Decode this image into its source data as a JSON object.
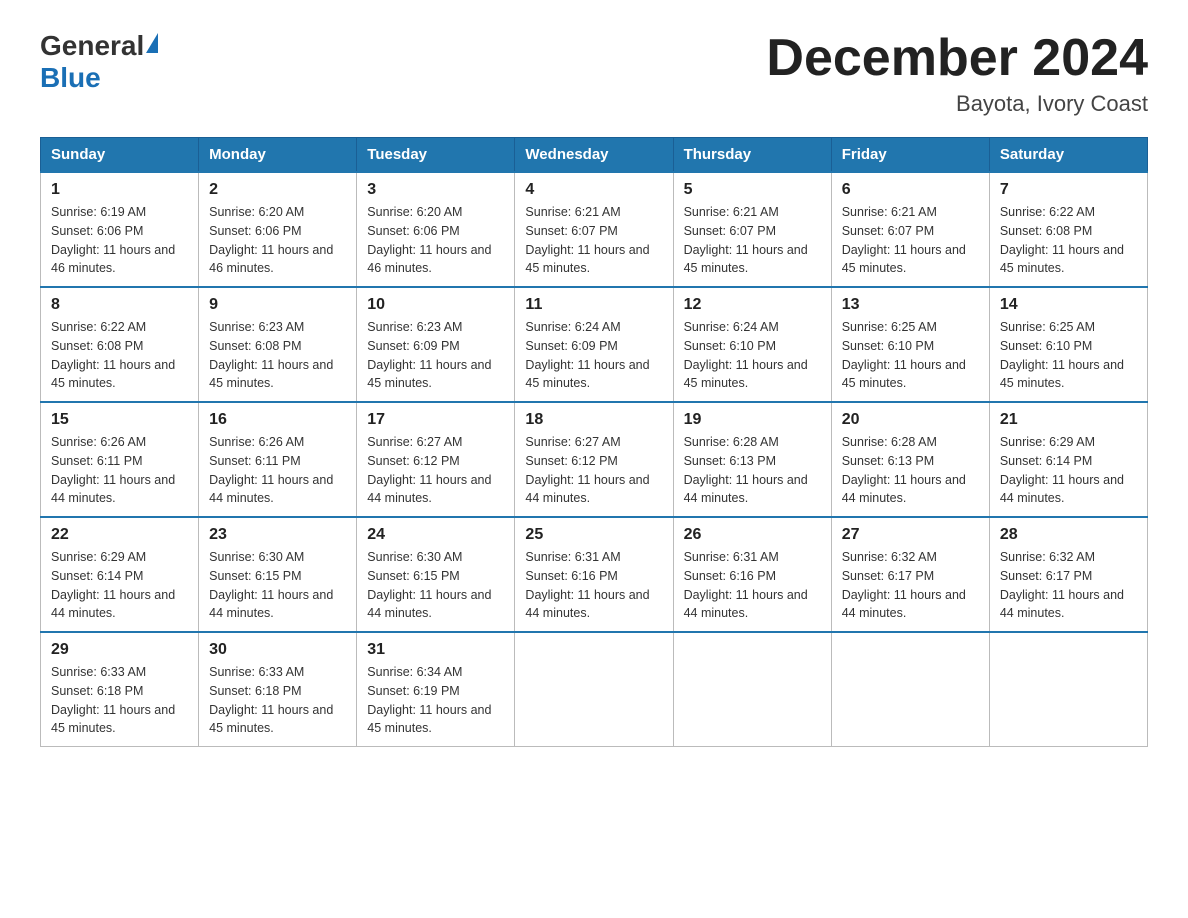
{
  "logo": {
    "general": "General",
    "blue": "Blue"
  },
  "header": {
    "month_year": "December 2024",
    "location": "Bayota, Ivory Coast"
  },
  "weekdays": [
    "Sunday",
    "Monday",
    "Tuesday",
    "Wednesday",
    "Thursday",
    "Friday",
    "Saturday"
  ],
  "weeks": [
    [
      {
        "day": "1",
        "sunrise": "6:19 AM",
        "sunset": "6:06 PM",
        "daylight": "11 hours and 46 minutes."
      },
      {
        "day": "2",
        "sunrise": "6:20 AM",
        "sunset": "6:06 PM",
        "daylight": "11 hours and 46 minutes."
      },
      {
        "day": "3",
        "sunrise": "6:20 AM",
        "sunset": "6:06 PM",
        "daylight": "11 hours and 46 minutes."
      },
      {
        "day": "4",
        "sunrise": "6:21 AM",
        "sunset": "6:07 PM",
        "daylight": "11 hours and 45 minutes."
      },
      {
        "day": "5",
        "sunrise": "6:21 AM",
        "sunset": "6:07 PM",
        "daylight": "11 hours and 45 minutes."
      },
      {
        "day": "6",
        "sunrise": "6:21 AM",
        "sunset": "6:07 PM",
        "daylight": "11 hours and 45 minutes."
      },
      {
        "day": "7",
        "sunrise": "6:22 AM",
        "sunset": "6:08 PM",
        "daylight": "11 hours and 45 minutes."
      }
    ],
    [
      {
        "day": "8",
        "sunrise": "6:22 AM",
        "sunset": "6:08 PM",
        "daylight": "11 hours and 45 minutes."
      },
      {
        "day": "9",
        "sunrise": "6:23 AM",
        "sunset": "6:08 PM",
        "daylight": "11 hours and 45 minutes."
      },
      {
        "day": "10",
        "sunrise": "6:23 AM",
        "sunset": "6:09 PM",
        "daylight": "11 hours and 45 minutes."
      },
      {
        "day": "11",
        "sunrise": "6:24 AM",
        "sunset": "6:09 PM",
        "daylight": "11 hours and 45 minutes."
      },
      {
        "day": "12",
        "sunrise": "6:24 AM",
        "sunset": "6:10 PM",
        "daylight": "11 hours and 45 minutes."
      },
      {
        "day": "13",
        "sunrise": "6:25 AM",
        "sunset": "6:10 PM",
        "daylight": "11 hours and 45 minutes."
      },
      {
        "day": "14",
        "sunrise": "6:25 AM",
        "sunset": "6:10 PM",
        "daylight": "11 hours and 45 minutes."
      }
    ],
    [
      {
        "day": "15",
        "sunrise": "6:26 AM",
        "sunset": "6:11 PM",
        "daylight": "11 hours and 44 minutes."
      },
      {
        "day": "16",
        "sunrise": "6:26 AM",
        "sunset": "6:11 PM",
        "daylight": "11 hours and 44 minutes."
      },
      {
        "day": "17",
        "sunrise": "6:27 AM",
        "sunset": "6:12 PM",
        "daylight": "11 hours and 44 minutes."
      },
      {
        "day": "18",
        "sunrise": "6:27 AM",
        "sunset": "6:12 PM",
        "daylight": "11 hours and 44 minutes."
      },
      {
        "day": "19",
        "sunrise": "6:28 AM",
        "sunset": "6:13 PM",
        "daylight": "11 hours and 44 minutes."
      },
      {
        "day": "20",
        "sunrise": "6:28 AM",
        "sunset": "6:13 PM",
        "daylight": "11 hours and 44 minutes."
      },
      {
        "day": "21",
        "sunrise": "6:29 AM",
        "sunset": "6:14 PM",
        "daylight": "11 hours and 44 minutes."
      }
    ],
    [
      {
        "day": "22",
        "sunrise": "6:29 AM",
        "sunset": "6:14 PM",
        "daylight": "11 hours and 44 minutes."
      },
      {
        "day": "23",
        "sunrise": "6:30 AM",
        "sunset": "6:15 PM",
        "daylight": "11 hours and 44 minutes."
      },
      {
        "day": "24",
        "sunrise": "6:30 AM",
        "sunset": "6:15 PM",
        "daylight": "11 hours and 44 minutes."
      },
      {
        "day": "25",
        "sunrise": "6:31 AM",
        "sunset": "6:16 PM",
        "daylight": "11 hours and 44 minutes."
      },
      {
        "day": "26",
        "sunrise": "6:31 AM",
        "sunset": "6:16 PM",
        "daylight": "11 hours and 44 minutes."
      },
      {
        "day": "27",
        "sunrise": "6:32 AM",
        "sunset": "6:17 PM",
        "daylight": "11 hours and 44 minutes."
      },
      {
        "day": "28",
        "sunrise": "6:32 AM",
        "sunset": "6:17 PM",
        "daylight": "11 hours and 44 minutes."
      }
    ],
    [
      {
        "day": "29",
        "sunrise": "6:33 AM",
        "sunset": "6:18 PM",
        "daylight": "11 hours and 45 minutes."
      },
      {
        "day": "30",
        "sunrise": "6:33 AM",
        "sunset": "6:18 PM",
        "daylight": "11 hours and 45 minutes."
      },
      {
        "day": "31",
        "sunrise": "6:34 AM",
        "sunset": "6:19 PM",
        "daylight": "11 hours and 45 minutes."
      },
      null,
      null,
      null,
      null
    ]
  ]
}
